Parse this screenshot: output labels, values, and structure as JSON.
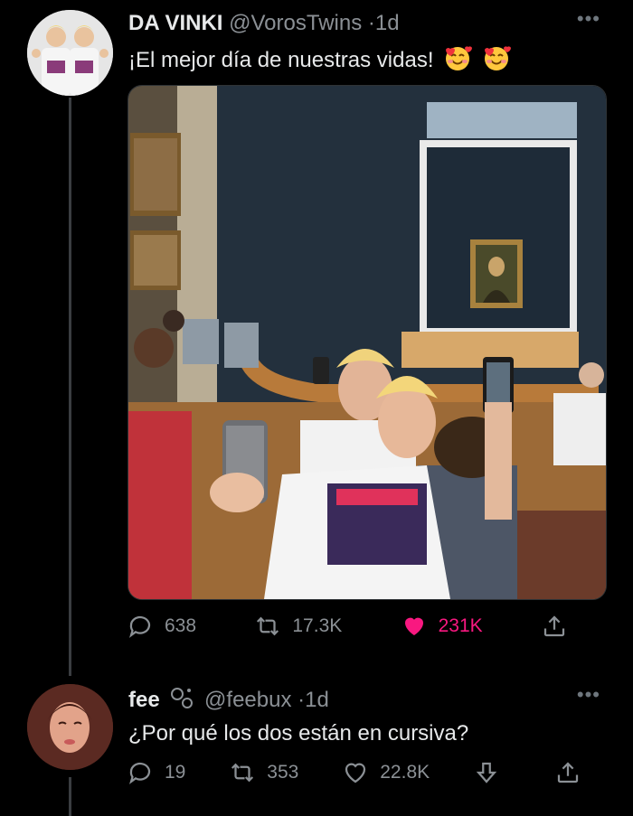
{
  "tweet": {
    "display_name": "DA VINKI",
    "handle": "@VorosTwins",
    "time": "1d",
    "text": "¡El mejor día de nuestras vidas!",
    "emoji_icons": [
      "smiling-face-with-hearts",
      "smiling-face-with-hearts"
    ],
    "replies": "638",
    "retweets": "17.3K",
    "likes": "231K",
    "liked": true
  },
  "reply": {
    "display_name": "fee",
    "handle": "@feebux",
    "time": "1d",
    "text": "¿Por qué los dos están en cursiva?",
    "replies": "19",
    "retweets": "353",
    "likes": "22.8K"
  },
  "colors": {
    "background": "#000000",
    "like_active": "#f91880",
    "muted": "#8b9095",
    "thread_line": "#3a3d41"
  }
}
